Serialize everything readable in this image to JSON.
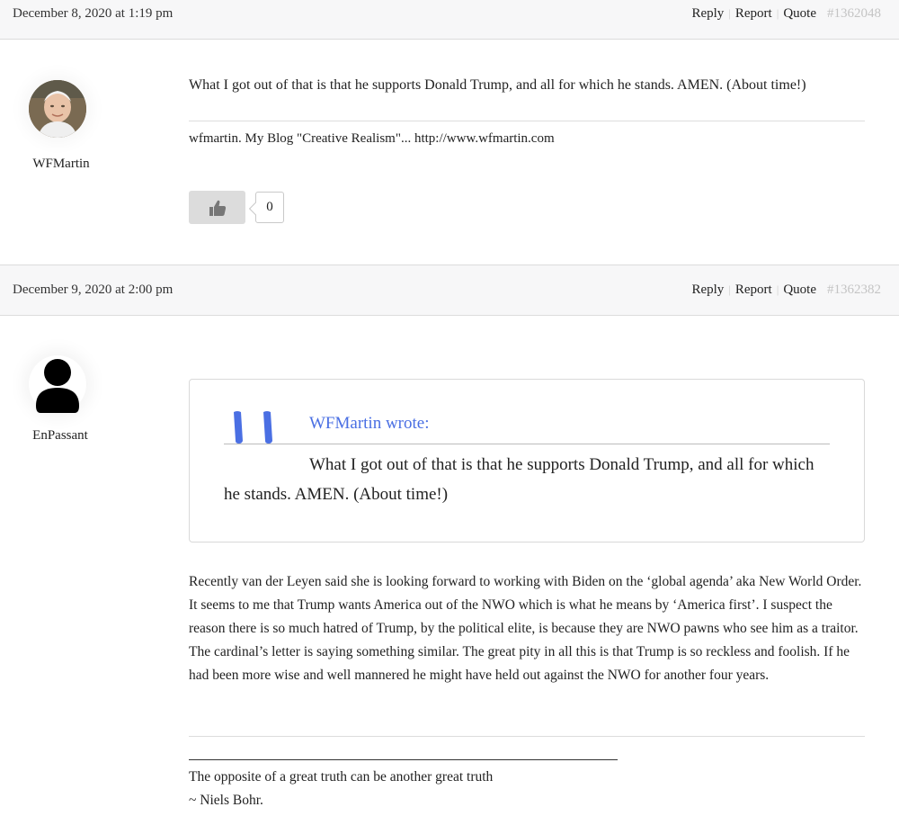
{
  "posts": [
    {
      "date": "December 8, 2020 at 1:19 pm",
      "actions": {
        "reply": "Reply",
        "report": "Report",
        "quote": "Quote"
      },
      "post_number": "#1362048",
      "author": "WFMartin",
      "body": "What I got out of that is that he supports Donald Trump, and all for which he stands.  AMEN. (About time!)",
      "signature": "wfmartin. My Blog \"Creative Realism\"... http://www.wfmartin.com",
      "like_count": "0"
    },
    {
      "date": "December 9, 2020 at 2:00 pm",
      "actions": {
        "reply": "Reply",
        "report": "Report",
        "quote": "Quote"
      },
      "post_number": "#1362382",
      "author": "EnPassant",
      "quote": {
        "author_line": "WFMartin wrote:",
        "text": "What I got out of that is that he supports Donald Trump, and all for which he stands. AMEN. (About time!)"
      },
      "body": "Recently van der Leyen said she is looking forward to working with Biden on the ‘global agenda’ aka New World Order. It seems to me that Trump wants America out of the NWO which is what he means by ‘America first’. I suspect the reason there is so much hatred of Trump, by the political elite, is because they are NWO pawns who see him as a traitor. The cardinal’s letter is saying something similar. The great pity in all this is that Trump is so reckless and foolish. If he had been more wise and well mannered he might have held out against the NWO for another four years.",
      "signature_line1": "The opposite of a great truth can be another great truth",
      "signature_line2": "~ Niels Bohr."
    }
  ],
  "colors": {
    "header_bg": "#f7f7f8",
    "quote_author": "#4a6fe3",
    "quote_marks": "#4a6fe3",
    "post_number": "#c4c4c4"
  },
  "icons": {
    "like": "thumbs-up-icon",
    "quote_marks": "quote-marks-icon",
    "default_avatar": "user-silhouette-icon"
  }
}
